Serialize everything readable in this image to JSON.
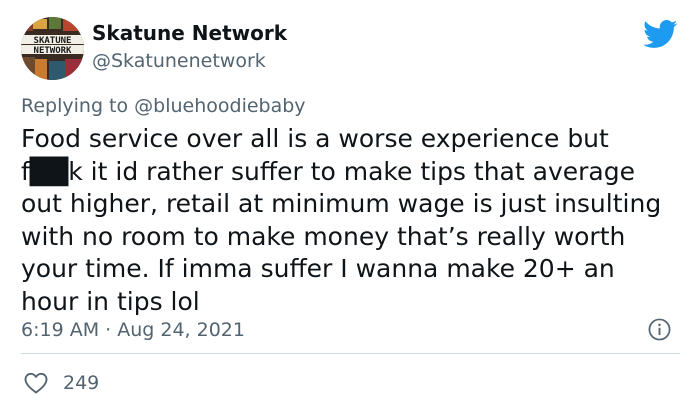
{
  "tweet": {
    "author": {
      "display_name": "Skatune Network",
      "handle": "@Skatunenetwork",
      "avatar_text": "SKATUNE NETWORK"
    },
    "replying_prefix": "Replying to ",
    "replying_to": "@bluehoodiebaby",
    "text": "Food service over all is a worse experience but\nf██k it id rather suffer to make tips that average\nout higher, retail at minimum wage is just insulting\nwith no room to make money that’s really worth\nyour time. If imma suffer I wanna make 20+ an\nhour in tips lol",
    "timestamp": "6:19 AM · Aug 24, 2021",
    "likes": "249",
    "icons": {
      "brand": "twitter-bird-icon",
      "info": "info-icon",
      "like": "heart-icon"
    },
    "colors": {
      "brand": "#1d9bf0",
      "secondary_text": "#536471",
      "primary_text": "#0f1419",
      "divider": "#cfd9de"
    }
  }
}
